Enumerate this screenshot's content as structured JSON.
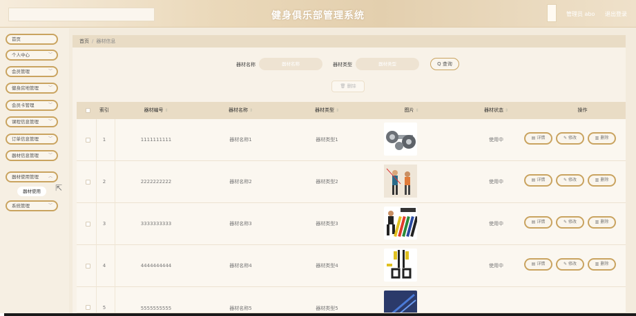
{
  "header": {
    "title": "健身俱乐部管理系统",
    "user": "管理员 abo",
    "logout": "退出登录"
  },
  "sidebar": {
    "items": [
      {
        "label": "首页",
        "chevron": false
      },
      {
        "label": "个人中心",
        "chevron": true
      },
      {
        "label": "会员管理",
        "chevron": true
      },
      {
        "label": "健身房地管理",
        "chevron": true
      },
      {
        "label": "会员卡管理",
        "chevron": true
      },
      {
        "label": "课程信息管理",
        "chevron": true
      },
      {
        "label": "订单信息管理",
        "chevron": true
      },
      {
        "label": "器材信息管理",
        "chevron": true
      },
      {
        "label": "器材使用管理",
        "chevron": true
      },
      {
        "label": "系统管理",
        "chevron": true
      }
    ],
    "submenu": "器材使用"
  },
  "breadcrumb": {
    "home": "首页",
    "sep": "/",
    "current": "器材信息"
  },
  "search": {
    "name_label": "器材名称",
    "name_placeholder": "器材名称",
    "type_label": "器材类型",
    "type_placeholder": "器材类型",
    "query_button": "Q 查询",
    "delete_button": "删除"
  },
  "table": {
    "headers": [
      "索引",
      "器材编号",
      "器材名称",
      "器材类型",
      "图片",
      "器材状态",
      "操作"
    ],
    "actions": {
      "detail": "详情",
      "edit": "修改",
      "delete": "删除"
    },
    "rows": [
      {
        "index": "1",
        "code": "1111111111",
        "name": "器材名称1",
        "type": "器材类型1",
        "status": "使用中"
      },
      {
        "index": "2",
        "code": "2222222222",
        "name": "器材名称2",
        "type": "器材类型2",
        "status": "使用中"
      },
      {
        "index": "3",
        "code": "3333333333",
        "name": "器材名称3",
        "type": "器材类型3",
        "status": "使用中"
      },
      {
        "index": "4",
        "code": "4444444444",
        "name": "器材名称4",
        "type": "器材类型4",
        "status": "使用中"
      },
      {
        "index": "5",
        "code": "5555555555",
        "name": "器材名称5",
        "type": "器材类型5",
        "status": ""
      }
    ]
  },
  "colors": {
    "accent": "#c9a35f",
    "header_bg": "#e9dcc5",
    "page_bg": "#f3ebdd"
  }
}
